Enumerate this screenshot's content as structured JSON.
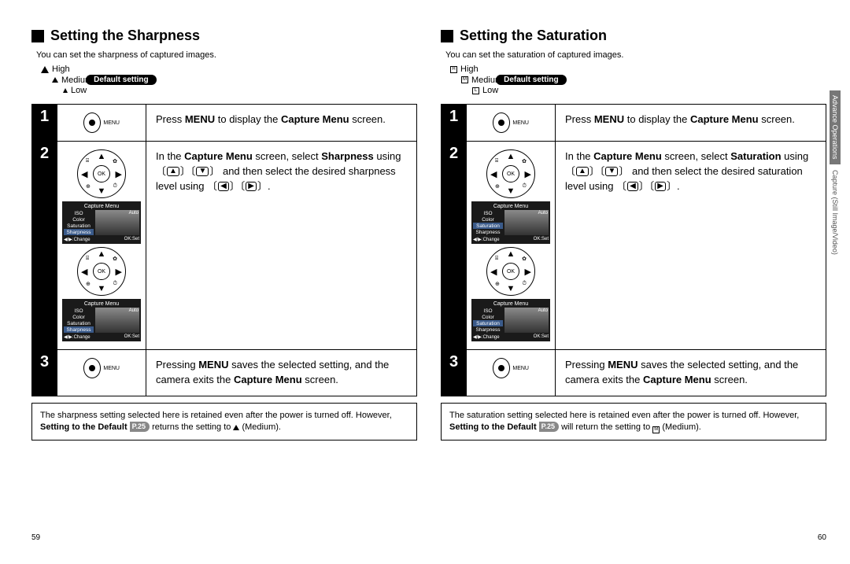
{
  "left": {
    "heading": "Setting the Sharpness",
    "intro": "You can set the sharpness of captured images.",
    "options": {
      "high": "High",
      "medium": "Medium",
      "low": "Low",
      "default_pill": "Default setting"
    },
    "steps": {
      "s1": {
        "num": "1",
        "text_pre": "Press ",
        "text_b1": "MENU",
        "text_mid": " to display the ",
        "text_b2": "Capture Menu",
        "text_post": " screen."
      },
      "s2": {
        "num": "2",
        "line1_a": "In the ",
        "line1_b": "Capture Menu",
        "line1_c": " screen, select ",
        "line2_a": "Sharpness",
        "line2_b": " using ",
        "line2_c": " and then select the desired sharpness level using "
      },
      "s3": {
        "num": "3",
        "a": "Pressing ",
        "b": "MENU",
        "c": " saves the selected setting, and the camera exits the ",
        "d": "Capture Menu",
        "e": " screen."
      }
    },
    "note": {
      "a": "The sharpness setting selected here is retained even after the power is turned off. However, ",
      "b": "Setting to the Default",
      "page_ref": "P.25",
      "c": " returns the setting to ",
      "d": " (Medium)."
    },
    "page_number": "59"
  },
  "right": {
    "heading": "Setting the Saturation",
    "intro": "You can set the saturation of captured images.",
    "options": {
      "high": "High",
      "medium": "Medium",
      "low": "Low",
      "default_pill": "Default setting"
    },
    "steps": {
      "s1": {
        "num": "1",
        "text_pre": "Press ",
        "text_b1": "MENU",
        "text_mid": " to display the ",
        "text_b2": "Capture Menu",
        "text_post": " screen."
      },
      "s2": {
        "num": "2",
        "line1_a": "In the ",
        "line1_b": "Capture Menu",
        "line1_c": " screen, select ",
        "line2_a": "Saturation",
        "line2_b": " using ",
        "line2_c": " and then select the desired saturation level using "
      },
      "s3": {
        "num": "3",
        "a": "Pressing ",
        "b": "MENU",
        "c": " saves the selected setting, and the camera exits the ",
        "d": "Capture Menu",
        "e": " screen."
      }
    },
    "note": {
      "a": "The saturation setting selected here is retained even after the power is turned off. However, ",
      "b": "Setting to the Default",
      "page_ref": "P.25",
      "c": " will return the setting to ",
      "d": " (Medium)."
    },
    "page_number": "60"
  },
  "side_tab": {
    "line1": "Advance Operations",
    "line2": "Capture (Still Image/Video)"
  },
  "menu_screen": {
    "title": "Capture Menu",
    "items": [
      "ISO",
      "Color",
      "Saturation",
      "Sharpness"
    ],
    "auto": "Auto",
    "foot_left": "◀/▶:Change",
    "foot_right": "OK:Set"
  },
  "icons": {
    "menu_label": "MENU",
    "ok_label": "OK",
    "sat_high": "H",
    "sat_med": "M",
    "sat_low": "L"
  }
}
